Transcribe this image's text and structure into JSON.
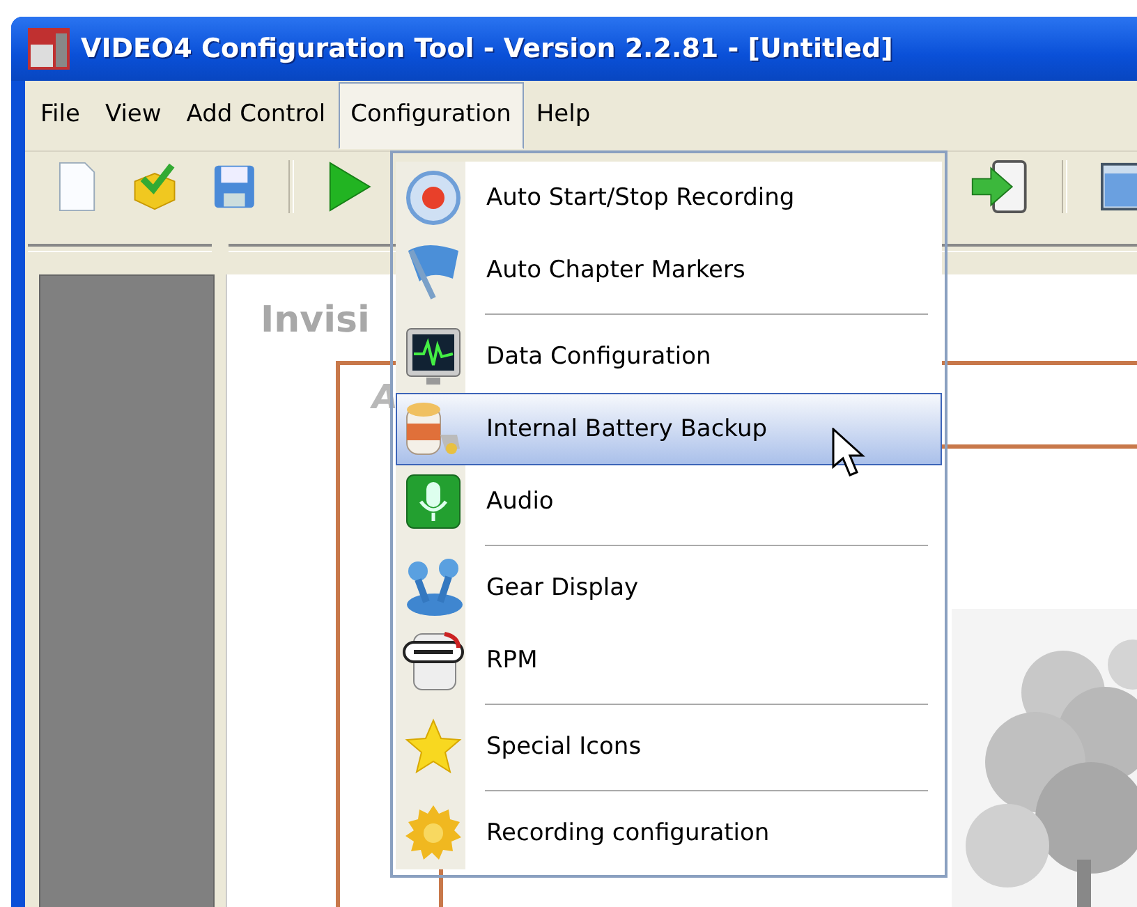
{
  "window": {
    "title": "VIDEO4 Configuration Tool - Version 2.2.81 - [Untitled]"
  },
  "menu_bar": [
    {
      "label": "File",
      "selected": false
    },
    {
      "label": "View",
      "selected": false
    },
    {
      "label": "Add Control",
      "selected": false
    },
    {
      "label": "Configuration",
      "selected": true
    },
    {
      "label": "Help",
      "selected": false
    }
  ],
  "canvas": {
    "heading": "Invisi",
    "label": "A"
  },
  "configuration_menu": [
    {
      "kind": "item",
      "label": "Auto Start/Stop Recording",
      "selected": false
    },
    {
      "kind": "item",
      "label": "Auto Chapter Markers",
      "selected": false
    },
    {
      "kind": "separator"
    },
    {
      "kind": "item",
      "label": "Data Configuration",
      "selected": false
    },
    {
      "kind": "item",
      "label": "Internal Battery Backup",
      "selected": true
    },
    {
      "kind": "item",
      "label": "Audio",
      "selected": false
    },
    {
      "kind": "separator"
    },
    {
      "kind": "item",
      "label": "Gear Display",
      "selected": false
    },
    {
      "kind": "item",
      "label": "RPM",
      "selected": false
    },
    {
      "kind": "separator"
    },
    {
      "kind": "item",
      "label": "Special Icons",
      "selected": false
    },
    {
      "kind": "separator"
    },
    {
      "kind": "item",
      "label": "Recording configuration",
      "selected": false
    }
  ]
}
